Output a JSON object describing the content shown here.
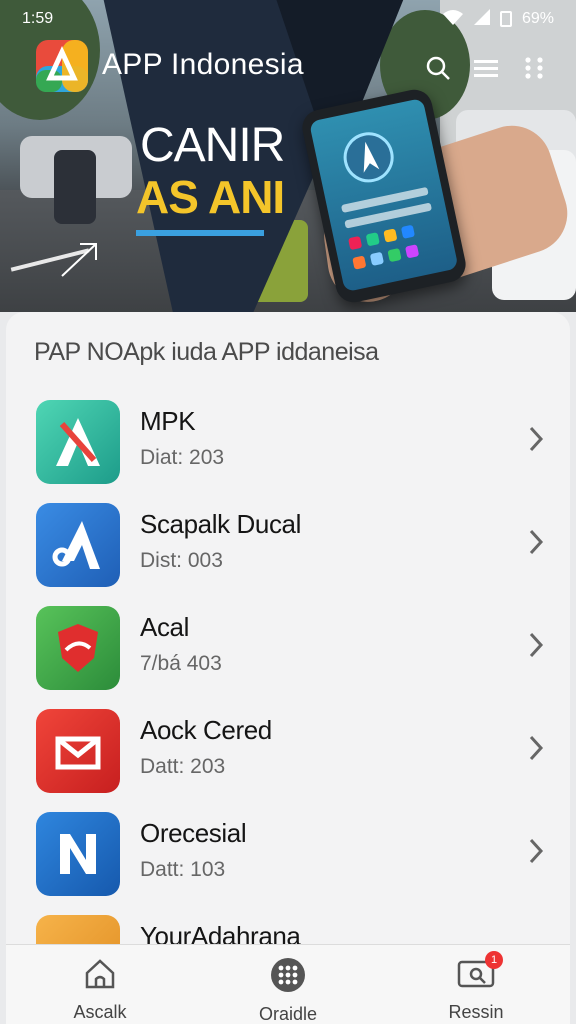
{
  "status_bar": {
    "time": "1:59",
    "battery": "69%"
  },
  "header": {
    "app_title": "APP Indonesia",
    "icons": [
      "search-icon",
      "menu-icon",
      "more-vert-icon"
    ]
  },
  "hero": {
    "headline_line1": "CANIR",
    "headline_line2": "AS ANI"
  },
  "section": {
    "title": "PAP NOApk iuda APP iddaneisa"
  },
  "apps": [
    {
      "name": "MPK",
      "meta": "Diat: 203",
      "icon": "teal-a-app-icon",
      "color": "#2bb3a0"
    },
    {
      "name": "Scapalk Ducal",
      "meta": "Dist: 003",
      "icon": "blue-a-app-icon",
      "color": "#2f78d0"
    },
    {
      "name": "Acal",
      "meta": "7/bá 403",
      "icon": "green-shield-app-icon",
      "color": "#3aa24a"
    },
    {
      "name": "Aock Cered",
      "meta": "Datt: 203",
      "icon": "red-mail-app-icon",
      "color": "#e0312f"
    },
    {
      "name": "Orecesial",
      "meta": "Datt: 103",
      "icon": "blue-n-app-icon",
      "color": "#1f6fc6"
    },
    {
      "name": "YourAdahrana",
      "meta": "",
      "icon": "orange-app-icon",
      "color": "#f0a33a"
    }
  ],
  "nav": {
    "tabs": [
      {
        "label": "Ascalk",
        "icon": "home-icon"
      },
      {
        "label": "Oraidle",
        "icon": "apps-grid-icon"
      },
      {
        "label": "Ressin",
        "icon": "notification-icon",
        "badge": "1"
      }
    ]
  }
}
